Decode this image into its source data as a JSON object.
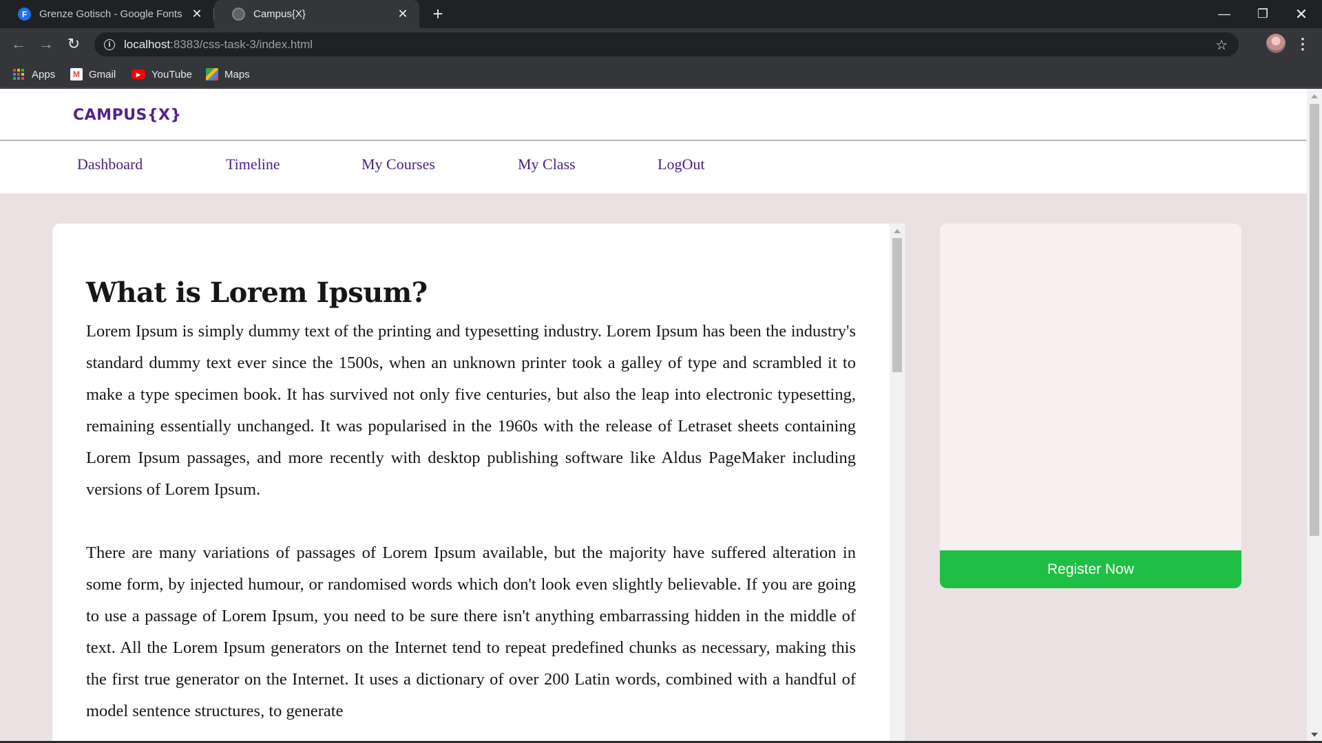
{
  "browser": {
    "tabs": [
      {
        "title": "Grenze Gotisch - Google Fonts",
        "favicon": "F",
        "icon": "google-fonts-icon"
      },
      {
        "title": "Campus{X}",
        "icon": "globe-icon"
      }
    ],
    "url_host": "localhost",
    "url_path": ":8383/css-task-3/index.html",
    "bookmarks": [
      {
        "label": "Apps",
        "icon": "apps-grid-icon"
      },
      {
        "label": "Gmail",
        "icon": "gmail-icon"
      },
      {
        "label": "YouTube",
        "icon": "youtube-icon"
      },
      {
        "label": "Maps",
        "icon": "maps-icon"
      }
    ]
  },
  "site": {
    "logo": "CAMPUS{X}",
    "nav": [
      "Dashboard",
      "Timeline",
      "My Courses",
      "My Class",
      "LogOut"
    ],
    "colors": {
      "brand": "#55208a",
      "register": "#1fbe45",
      "background": "#ebe1e3"
    }
  },
  "article": {
    "title": "What is Lorem Ipsum?",
    "paragraphs": [
      "Lorem Ipsum is simply dummy text of the printing and typesetting industry. Lorem Ipsum has been the industry's standard dummy text ever since the 1500s, when an unknown printer took a galley of type and scrambled it to make a type specimen book. It has survived not only five centuries, but also the leap into electronic typesetting, remaining essentially unchanged. It was popularised in the 1960s with the release of Letraset sheets containing Lorem Ipsum passages, and more recently with desktop publishing software like Aldus PageMaker including versions of Lorem Ipsum.",
      "There are many variations of passages of Lorem Ipsum available, but the majority have suffered alteration in some form, by injected humour, or randomised words which don't look even slightly believable. If you are going to use a passage of Lorem Ipsum, you need to be sure there isn't anything embarrassing hidden in the middle of text. All the Lorem Ipsum generators on the Internet tend to repeat predefined chunks as necessary, making this the first true generator on the Internet. It uses a dictionary of over 200 Latin words, combined with a handful of model sentence structures, to generate"
    ]
  },
  "sidebar": {
    "register_label": "Register Now"
  }
}
